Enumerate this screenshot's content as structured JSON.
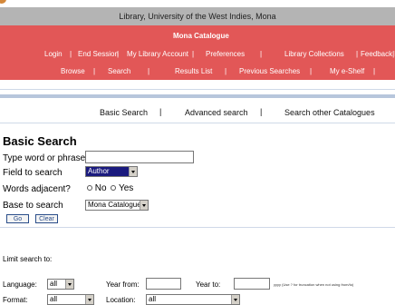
{
  "banner": {
    "title": "Library, University of the West Indies, Mona"
  },
  "nav": {
    "catalogue_title": "Mona Catalogue",
    "row1": [
      "Login",
      "End Session",
      "My Library Account",
      "Preferences",
      "Library Collections",
      "Feedback|Hel"
    ],
    "row2": [
      "Browse",
      "Search",
      "Results List",
      "Previous Searches",
      "My e-Shelf"
    ]
  },
  "tabs": [
    "Basic Search",
    "Advanced search",
    "Search other Catalogues"
  ],
  "form": {
    "heading": "Basic Search",
    "word_label": "Type word or phrase",
    "word_value": "",
    "field_label": "Field to search",
    "field_value": "Author",
    "adjacent_label": "Words adjacent?",
    "adjacent_no": "No",
    "adjacent_yes": "Yes",
    "base_label": "Base to search",
    "base_value": "Mona Catalogue",
    "go_label": "Go",
    "clear_label": "Clear"
  },
  "limits": {
    "heading": "Limit search to:",
    "language_label": "Language:",
    "language_value": "all",
    "year_from_label": "Year from:",
    "year_to_label": "Year to:",
    "year_hint": "yyyy (Use ? for truncation when not using from/to)",
    "format_label": "Format:",
    "format_value": "all",
    "location_label": "Location:",
    "location_value": "all"
  },
  "colors": {
    "nav_bg": "#e25757",
    "banner_bg": "#b4b4b4",
    "field_selected_bg": "#1a1a7e",
    "link_blue": "#2a4d8a"
  }
}
